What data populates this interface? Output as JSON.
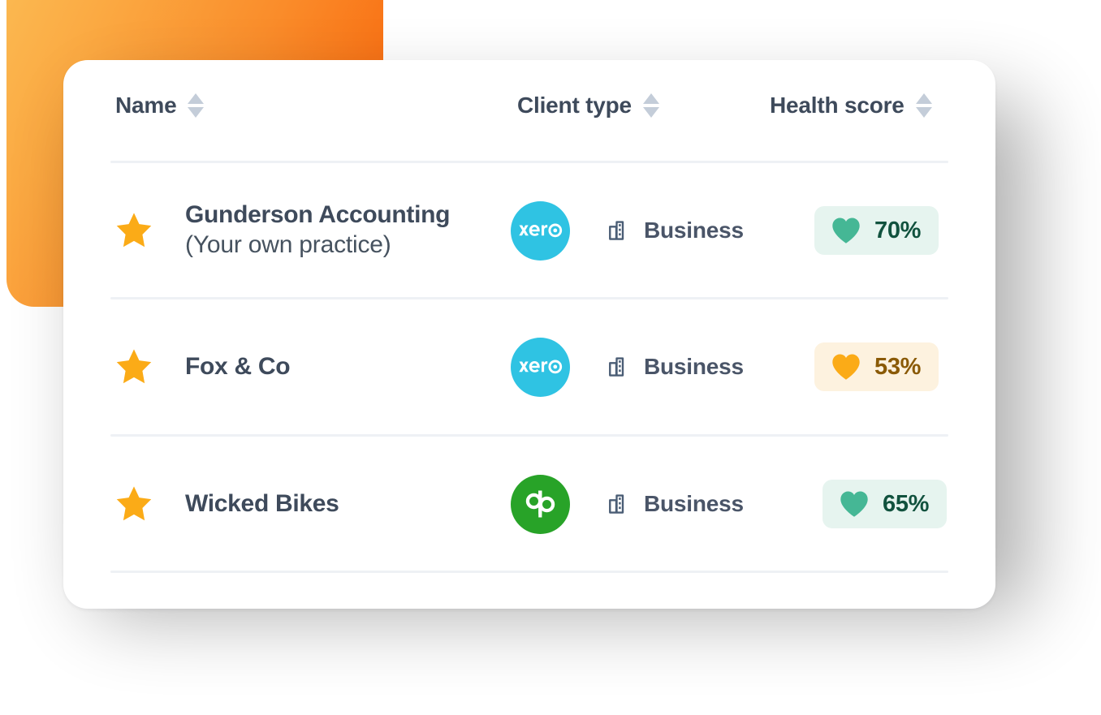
{
  "decor": {
    "orange_block": "orange-gradient-block",
    "gradient_from": "#FBBA52",
    "gradient_to": "#F86A10"
  },
  "table": {
    "columns": [
      {
        "label": "Name",
        "sort_icon": "sort-arrows-icon"
      },
      {
        "label": "Client type",
        "sort_icon": "sort-arrows-icon"
      },
      {
        "label": "Health score",
        "sort_icon": "sort-arrows-icon"
      }
    ],
    "rows": [
      {
        "starred": true,
        "star_icon": "star-icon",
        "name": "Gunderson Accounting",
        "name_note": "(Your own practice)",
        "logo": "xero-logo",
        "logo_text": "xero",
        "logo_color": "#2FC3E3",
        "type_icon": "building-icon",
        "client_type": "Business",
        "health_score": "70%",
        "health_state": "good",
        "health_icon": "heart-icon",
        "health_bg": "#E6F4EF",
        "health_heart_color": "#45B795",
        "health_text_color": "#11523E"
      },
      {
        "starred": true,
        "star_icon": "star-icon",
        "name": "Fox & Co",
        "name_note": "",
        "logo": "xero-logo",
        "logo_text": "xero",
        "logo_color": "#2FC3E3",
        "type_icon": "building-icon",
        "client_type": "Business",
        "health_score": "53%",
        "health_state": "warn",
        "health_icon": "heart-icon",
        "health_bg": "#FDF2DF",
        "health_heart_color": "#FBAB17",
        "health_text_color": "#8A5A06"
      },
      {
        "starred": true,
        "star_icon": "star-icon",
        "name": "Wicked Bikes",
        "name_note": "",
        "logo": "dp-logo",
        "logo_text": "dp",
        "logo_color": "#28A328",
        "type_icon": "building-icon",
        "client_type": "Business",
        "health_score": "65%",
        "health_state": "good",
        "health_icon": "heart-icon",
        "health_bg": "#E6F4EF",
        "health_heart_color": "#45B795",
        "health_text_color": "#11523E"
      }
    ]
  }
}
